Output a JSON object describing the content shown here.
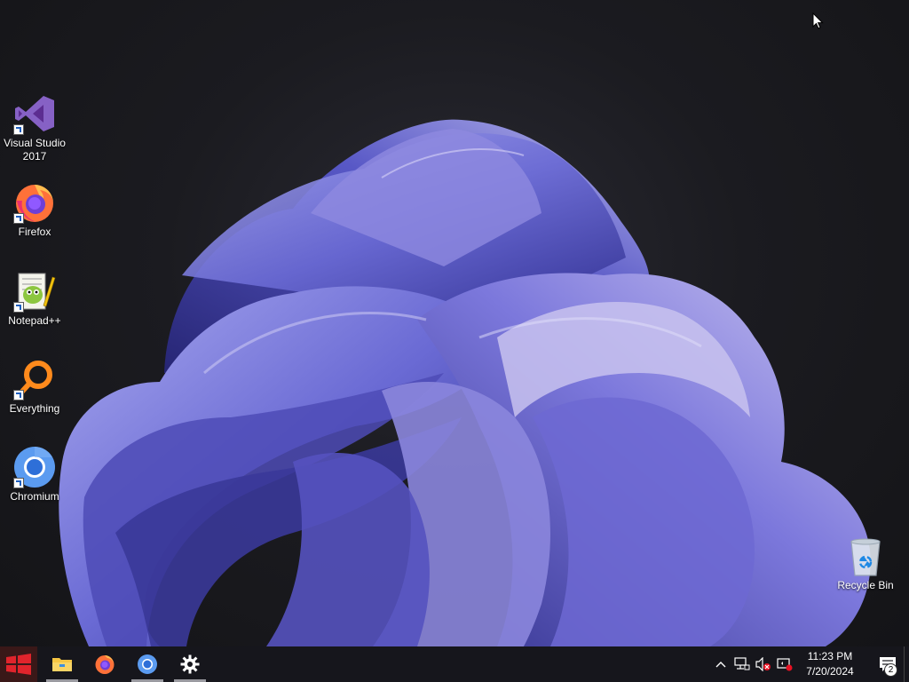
{
  "desktop": {
    "icons": [
      {
        "label_line1": "Visual Studio",
        "label_line2": "2017",
        "icon": "visual-studio-icon"
      },
      {
        "label": "Firefox",
        "icon": "firefox-icon"
      },
      {
        "label": "Notepad++",
        "icon": "notepadpp-icon"
      },
      {
        "label": "Everything",
        "icon": "everything-icon"
      },
      {
        "label": "Chromium",
        "icon": "chromium-icon"
      }
    ],
    "recycle_bin": {
      "label": "Recycle Bin",
      "icon": "recycle-bin-icon"
    }
  },
  "taskbar": {
    "pinned": [
      {
        "name": "file-explorer",
        "icon": "folder-icon"
      },
      {
        "name": "firefox",
        "icon": "firefox-icon"
      },
      {
        "name": "chromium",
        "icon": "chromium-icon"
      },
      {
        "name": "settings",
        "icon": "gear-icon"
      }
    ],
    "clock": {
      "time": "11:23 PM",
      "date": "7/20/2024"
    },
    "notifications": {
      "count": "2"
    }
  },
  "colors": {
    "wallpaper_accent": "#6b6bd6",
    "start_button": "#e0242c",
    "taskbar": "#16161c"
  }
}
